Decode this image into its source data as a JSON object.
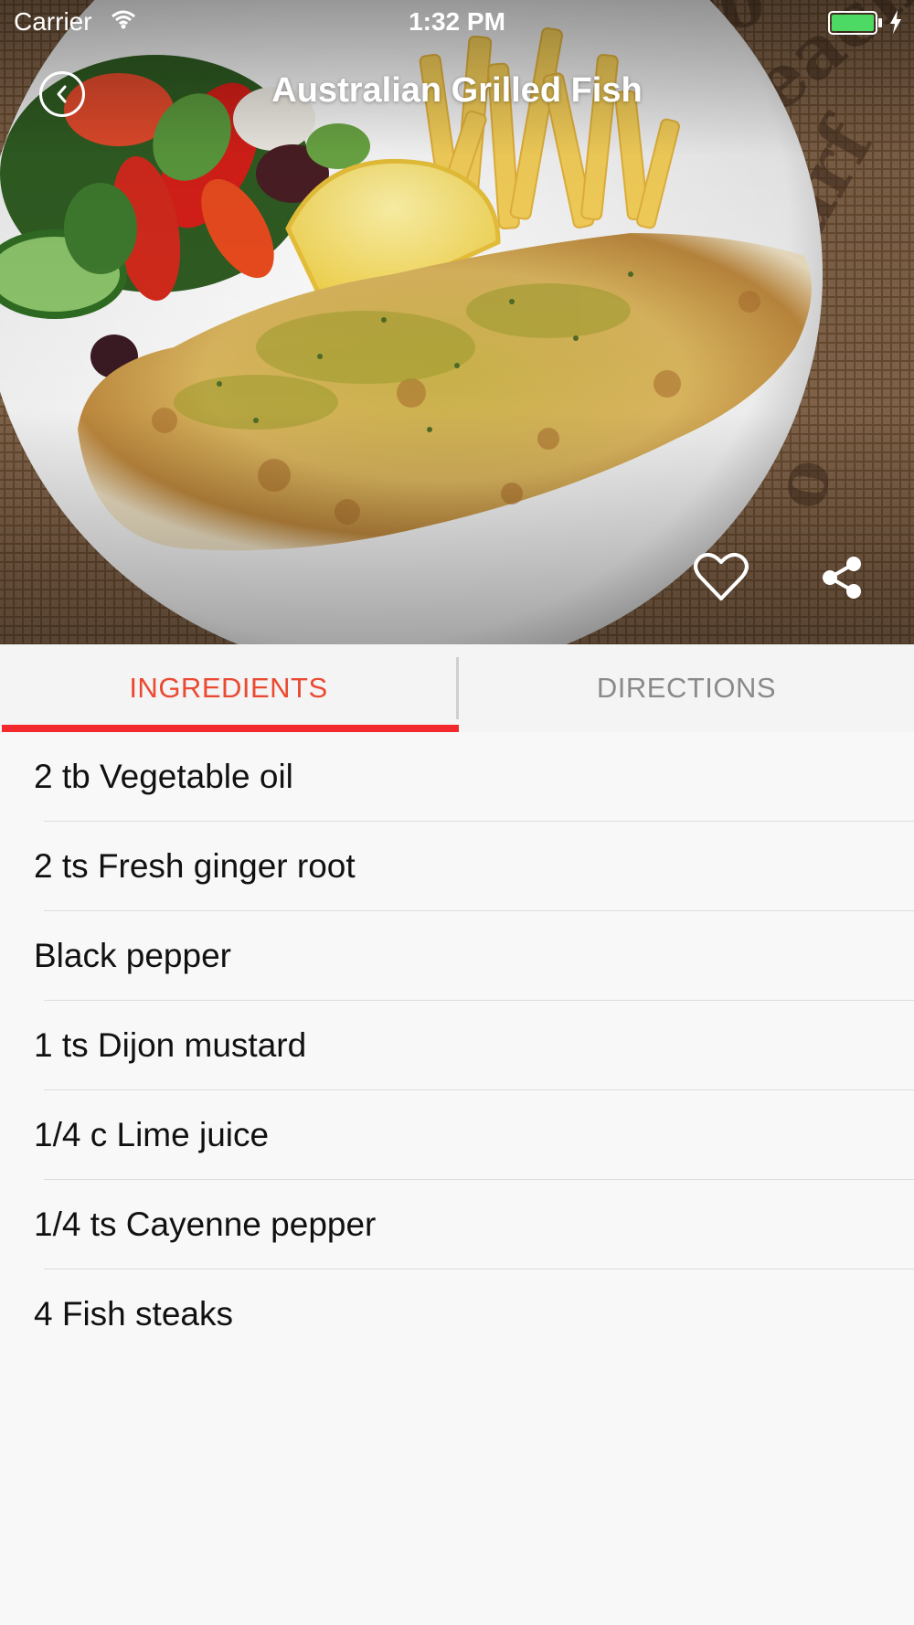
{
  "status_bar": {
    "carrier": "Carrier",
    "time": "1:32 PM",
    "battery_color": "#4cd964"
  },
  "header": {
    "title": "Australian Grilled Fish",
    "back_icon": "chevron-left-circle-icon",
    "favorite_icon": "heart-outline-icon",
    "share_icon": "share-icon"
  },
  "tabs": [
    {
      "label": "INGREDIENTS",
      "active": true
    },
    {
      "label": "DIRECTIONS",
      "active": false
    }
  ],
  "colors": {
    "accent": "#ea4a32",
    "indicator": "#f22a2e",
    "inactive_tab": "#8a8a8a"
  },
  "ingredients": [
    "2 tb Vegetable oil",
    "2 ts Fresh ginger root",
    "Black pepper",
    "1 ts Dijon mustard",
    "1/4 c Lime juice",
    "1/4 ts Cayenne pepper",
    "4 Fish steaks"
  ]
}
